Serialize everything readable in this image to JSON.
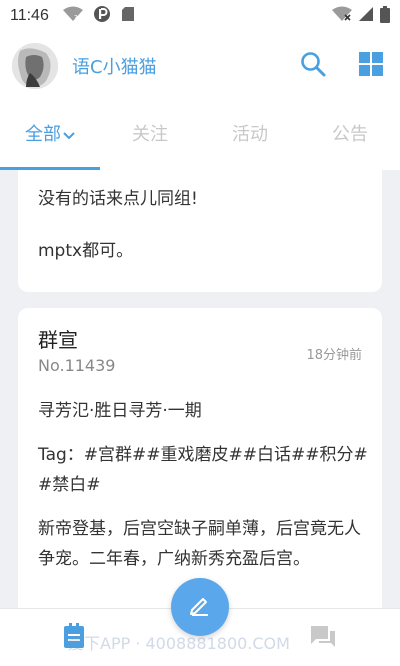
{
  "status_bar": {
    "time": "11:46"
  },
  "header": {
    "title": "语C小猫猫",
    "accent": "#4a9fe0"
  },
  "tabs": [
    {
      "label": "全部",
      "active": true
    },
    {
      "label": "关注",
      "active": false
    },
    {
      "label": "活动",
      "active": false
    },
    {
      "label": "公告",
      "active": false
    }
  ],
  "posts": [
    {
      "lines": [
        "没有的话来点儿同组!",
        "mptx都可。"
      ]
    },
    {
      "title": "群宣",
      "number": "No.11439",
      "time": "18分钟前",
      "paragraphs": [
        "寻芳氾·胜日寻芳·一期",
        "Tag：#宫群##重戏磨皮##白话##积分##禁白#",
        "新帝登基，后宫空缺子嗣单薄，后宫竟无人争宠。二年春，广纳新秀充盈后宫。"
      ]
    }
  ],
  "watermark": "爱下APP · 4008881800.COM",
  "icons": {
    "status": [
      "wifi-question-icon",
      "p-badge-icon",
      "sd-card-icon",
      "wifi-off-icon",
      "signal-icon",
      "battery-icon"
    ],
    "header": [
      "search-icon",
      "grid-icon"
    ],
    "bottom": [
      "feed-icon",
      "compose-icon",
      "message-icon"
    ]
  }
}
